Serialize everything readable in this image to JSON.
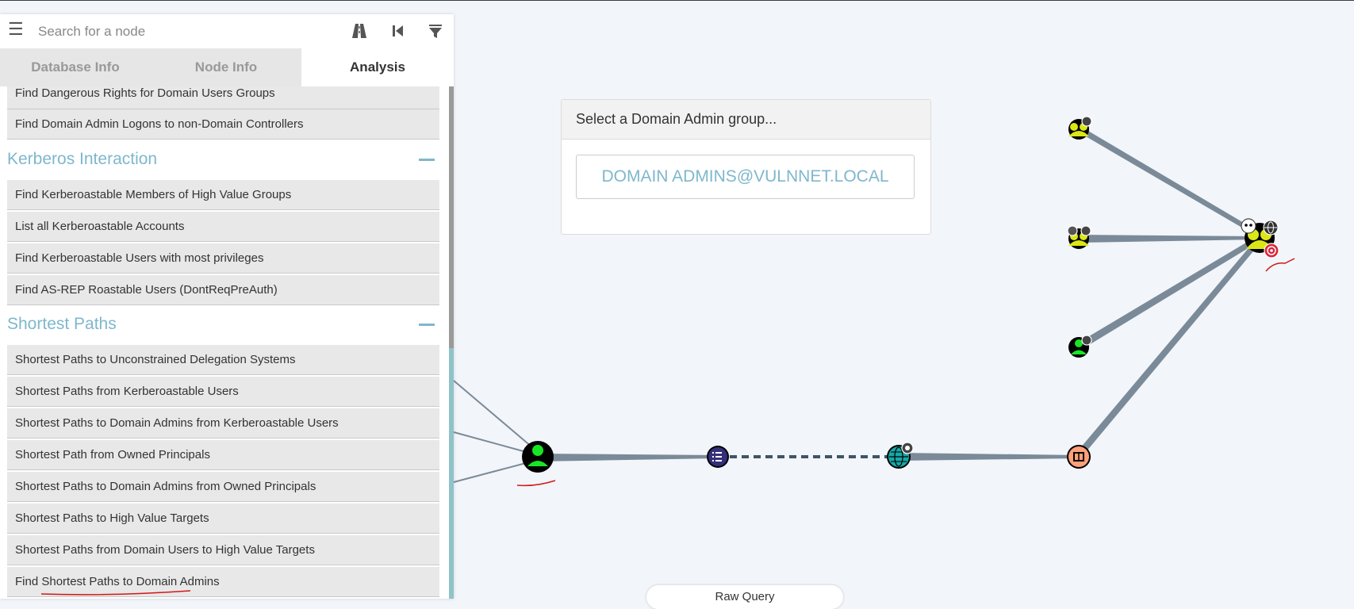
{
  "search": {
    "placeholder": "Search for a node"
  },
  "tabs": [
    {
      "label": "Database Info",
      "active": false
    },
    {
      "label": "Node Info",
      "active": false
    },
    {
      "label": "Analysis",
      "active": true
    }
  ],
  "analysis": {
    "pre_items": [
      "Find Dangerous Rights for Domain Users Groups",
      "Find Domain Admin Logons to non-Domain Controllers"
    ],
    "kerberos": {
      "title": "Kerberos Interaction",
      "items": [
        "Find Kerberoastable Members of High Value Groups",
        "List all Kerberoastable Accounts",
        "Find Kerberoastable Users with most privileges",
        "Find AS-REP Roastable Users (DontReqPreAuth)"
      ]
    },
    "shortest": {
      "title": "Shortest Paths",
      "items": [
        "Shortest Paths to Unconstrained Delegation Systems",
        "Shortest Paths from Kerberoastable Users",
        "Shortest Paths to Domain Admins from Kerberoastable Users",
        "Shortest Path from Owned Principals",
        "Shortest Paths to Domain Admins from Owned Principals",
        "Shortest Paths to High Value Targets",
        "Shortest Paths from Domain Users to High Value Targets",
        "Find Shortest Paths to Domain Admins"
      ]
    }
  },
  "domain_admin_selector": {
    "title": "Select a Domain Admin group...",
    "value": "DOMAIN ADMINS@VULNNET.LOCAL"
  },
  "raw_query": {
    "label": "Raw Query"
  },
  "graph": {
    "nodes": [
      {
        "id": "user",
        "kind": "user",
        "icon": "user-icon",
        "color": "#17e625"
      },
      {
        "id": "ou",
        "kind": "ou",
        "icon": "list-icon",
        "color": "#352e7a"
      },
      {
        "id": "domain",
        "kind": "domain",
        "icon": "globe-icon",
        "color": "#17a8a8"
      },
      {
        "id": "gpo",
        "kind": "gpo",
        "icon": "gpo-icon",
        "color": "#ffa07a"
      },
      {
        "id": "group1",
        "kind": "group",
        "icon": "group-icon",
        "color": "#dbe617"
      },
      {
        "id": "group2",
        "kind": "group",
        "icon": "group-icon",
        "color": "#dbe617"
      },
      {
        "id": "user2",
        "kind": "user",
        "icon": "user-icon",
        "color": "#17e625"
      },
      {
        "id": "da",
        "kind": "group",
        "icon": "target-icon",
        "color": "#dbe617"
      }
    ],
    "edges": [
      {
        "from": "user",
        "to": "ou",
        "dashed": false
      },
      {
        "from": "ou",
        "to": "domain",
        "dashed": true
      },
      {
        "from": "domain",
        "to": "gpo",
        "dashed": false
      },
      {
        "from": "gpo",
        "to": "da",
        "dashed": false
      },
      {
        "from": "group1",
        "to": "da",
        "dashed": false
      },
      {
        "from": "group2",
        "to": "da",
        "dashed": false
      },
      {
        "from": "user2",
        "to": "da",
        "dashed": false
      }
    ]
  }
}
